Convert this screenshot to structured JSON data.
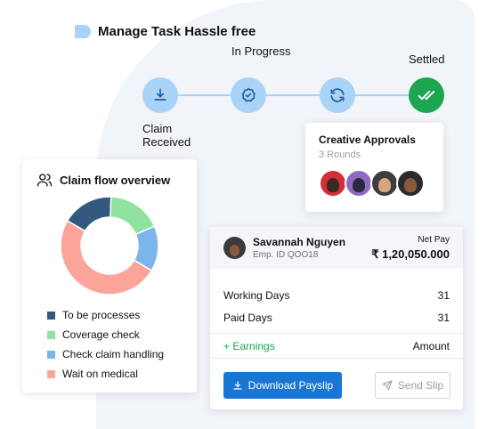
{
  "header": {
    "title": "Manage Task Hassle free"
  },
  "steps": [
    {
      "label": "Claim Received",
      "icon": "download-icon"
    },
    {
      "label": "In Progress",
      "icon": "badge-check-icon"
    },
    {
      "label": "",
      "icon": "refresh-icon"
    },
    {
      "label": "Settled",
      "icon": "double-check-icon"
    }
  ],
  "approvals": {
    "title": "Creative Approvals",
    "subtitle": "3 Rounds",
    "avatar_count": 4
  },
  "overview": {
    "title": "Claim flow overview",
    "legend": [
      {
        "label": "To be processes",
        "color": "#34597f"
      },
      {
        "label": "Coverage check",
        "color": "#90e2a0"
      },
      {
        "label": "Check claim handling",
        "color": "#7cb5ec"
      },
      {
        "label": "Wait on medical",
        "color": "#fba49a"
      }
    ]
  },
  "chart_data": {
    "type": "pie",
    "categories": [
      "To be processes",
      "Coverage check",
      "Check claim handling",
      "Wait on medical"
    ],
    "values": [
      17,
      18,
      15,
      50
    ],
    "colors": [
      "#34597f",
      "#90e2a0",
      "#7cb5ec",
      "#fba49a"
    ],
    "title": "Claim flow overview"
  },
  "payslip": {
    "employee_name": "Savannah Nguyen",
    "employee_id": "Emp. ID QOO18",
    "net_pay_label": "Net Pay",
    "net_pay_amount": "₹ 1,20,050.000",
    "rows": [
      {
        "label": "Working Days",
        "value": "31"
      },
      {
        "label": "Paid Days",
        "value": "31"
      }
    ],
    "earnings_label": "+ Earnings",
    "amount_label": "Amount",
    "download_label": "Download Payslip",
    "send_label": "Send Slip"
  }
}
